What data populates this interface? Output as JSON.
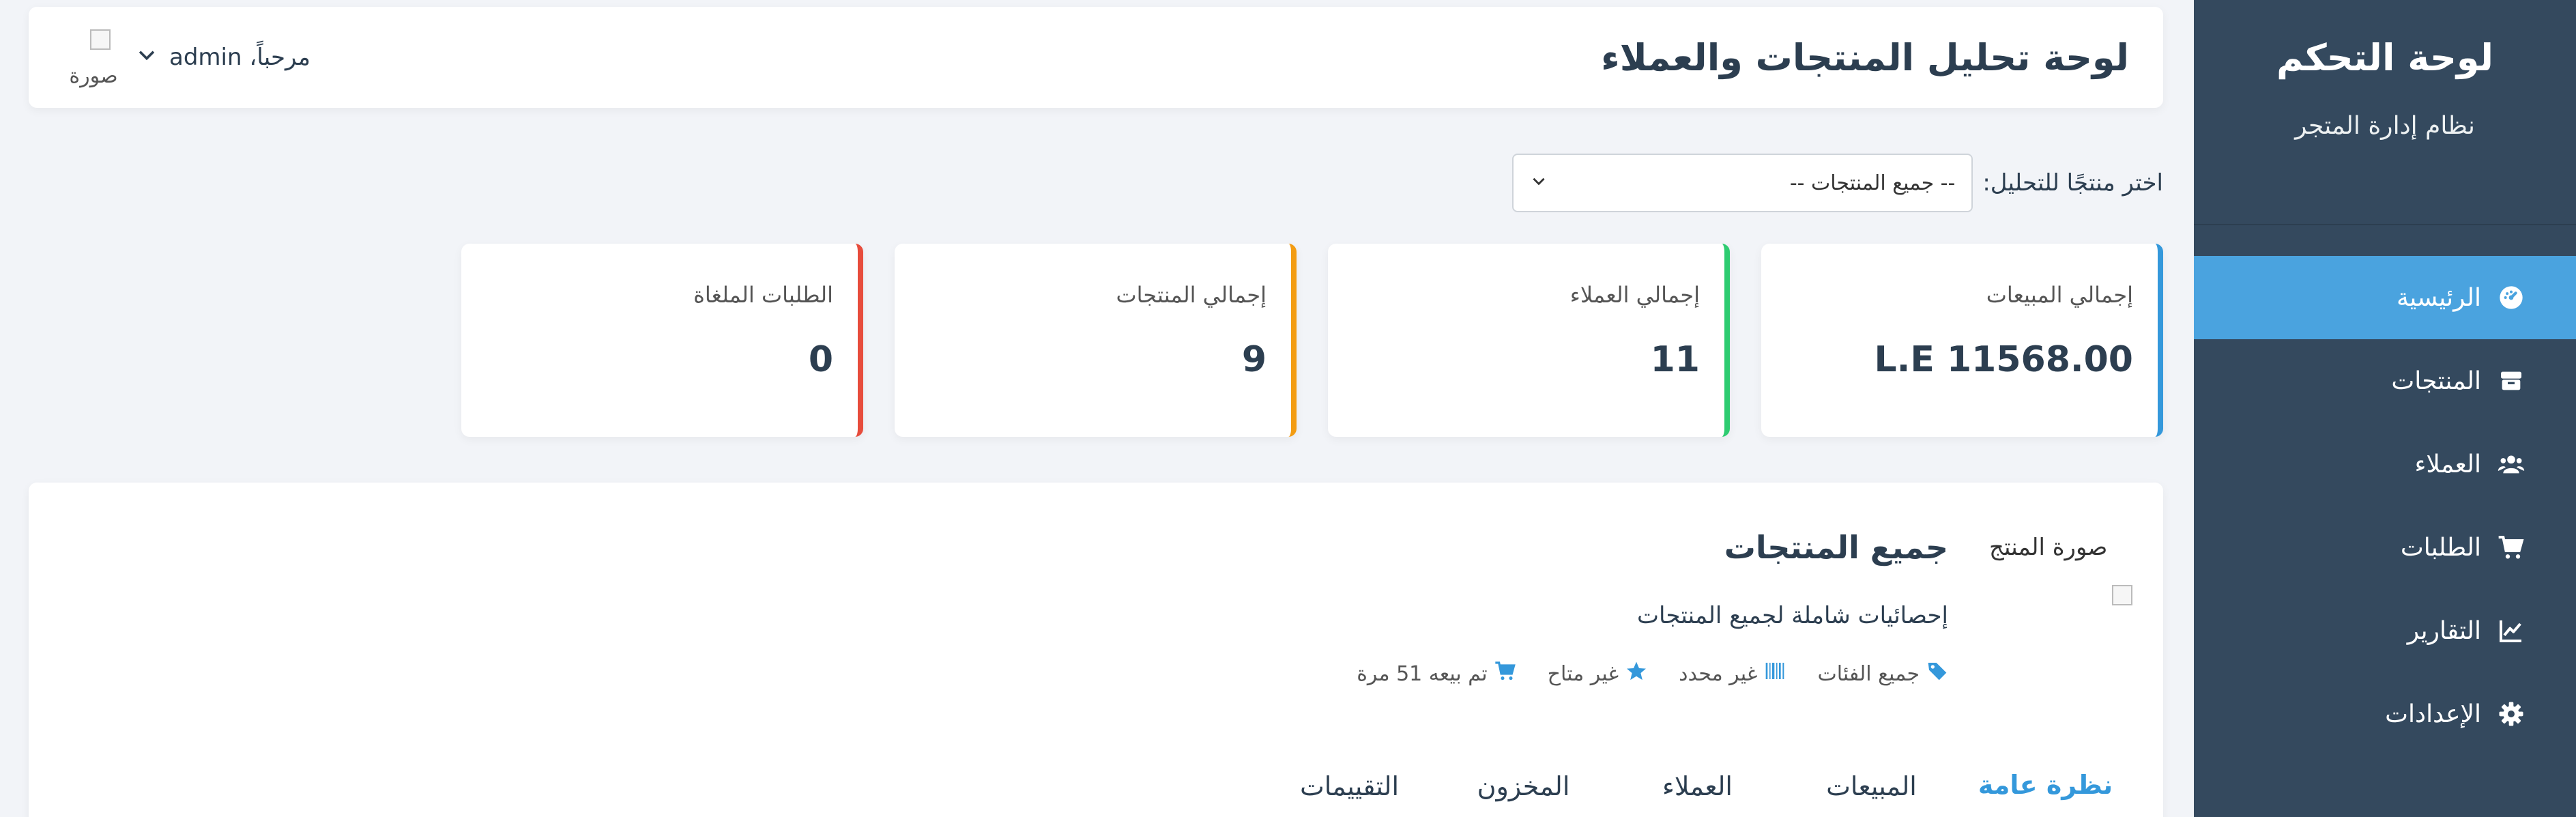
{
  "sidebar": {
    "title": "لوحة التحكم",
    "subtitle": "نظام إدارة المتجر",
    "items": [
      {
        "label": "الرئيسية",
        "icon": "dashboard-icon",
        "active": true
      },
      {
        "label": "المنتجات",
        "icon": "box-icon"
      },
      {
        "label": "العملاء",
        "icon": "users-icon"
      },
      {
        "label": "الطلبات",
        "icon": "cart-icon"
      },
      {
        "label": "التقارير",
        "icon": "chart-line-icon"
      },
      {
        "label": "الإعدادات",
        "icon": "gear-icon"
      }
    ]
  },
  "header": {
    "title": "لوحة تحليل المنتجات والعملاء",
    "greeting": "مرحباً، admin",
    "avatar_alt": "صورة"
  },
  "filter": {
    "label": "اختر منتجًا للتحليل:",
    "selected": "-- جميع المنتجات --"
  },
  "stats": [
    {
      "label": "إجمالي المبيعات",
      "value": "L.E 11568.00",
      "color": "#3498db"
    },
    {
      "label": "إجمالي العملاء",
      "value": "11",
      "color": "#2ecc71"
    },
    {
      "label": "إجمالي المنتجات",
      "value": "9",
      "color": "#f39c12"
    },
    {
      "label": "الطلبات الملغاة",
      "value": "0",
      "color": "#e74c3c"
    }
  ],
  "product": {
    "image_alt": "صورة المنتج",
    "title": "جميع المنتجات",
    "description": "إحصائيات شاملة لجميع المنتجات",
    "meta": {
      "category": "جميع الفئات",
      "barcode": "غير محدد",
      "rating": "غير متاح",
      "sold": "تم بيعه 51 مرة"
    }
  },
  "tabs": [
    {
      "label": "نظرة عامة",
      "active": true
    },
    {
      "label": "المبيعات"
    },
    {
      "label": "العملاء"
    },
    {
      "label": "المخزون"
    },
    {
      "label": "التقييمات"
    }
  ],
  "colors": {
    "sidebar_bg": "#34495e",
    "accent": "#3498db",
    "active_item": "#4aa3df"
  }
}
